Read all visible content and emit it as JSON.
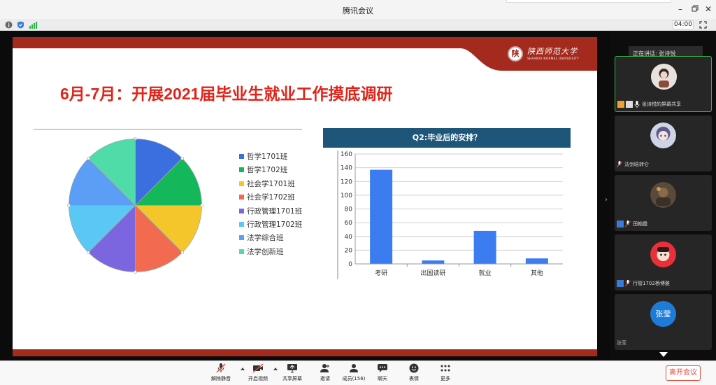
{
  "window": {
    "title": "腾讯会议"
  },
  "infobar": {
    "timer": "04:00"
  },
  "slide": {
    "title": "6月-7月：开展2021届毕业生就业工作摸底调研",
    "logo_name": "陕西师范大学",
    "logo_sub": "SHAANXI NORMAL UNIVERSITY",
    "logo_seal": "陕"
  },
  "chart_data": [
    {
      "type": "pie",
      "categories": [
        "哲学1701班",
        "哲学1702班",
        "社会学1701班",
        "社会学1702班",
        "行政管理1701班",
        "行政管理1702班",
        "法学综合班",
        "法学创新班"
      ],
      "values": [
        12.5,
        12.5,
        12.5,
        12.5,
        12.5,
        12.5,
        12.5,
        12.5
      ],
      "colors": [
        "#3b6fe0",
        "#14b85a",
        "#f5c62a",
        "#f26a4f",
        "#7b66e0",
        "#5ac8f5",
        "#5a9ef5",
        "#4fdca8"
      ],
      "legend": "right"
    },
    {
      "type": "bar",
      "title": "Q2:毕业后的安排？",
      "categories": [
        "考研",
        "出国读研",
        "就业",
        "其他"
      ],
      "values": [
        137,
        5,
        48,
        8
      ],
      "yticks": [
        0,
        20,
        40,
        60,
        80,
        100,
        120,
        140,
        160
      ],
      "ylim": [
        0,
        160
      ],
      "grid": true,
      "color": "#3b7df0"
    }
  ],
  "participants": {
    "speaking": "正在讲话: 张诗悦",
    "tiles": [
      {
        "name": "张诗悦的屏幕共享",
        "active": true
      },
      {
        "name": "法剑晗转仑"
      },
      {
        "name": "田翰霞"
      },
      {
        "name": "行管1702杨博雅"
      },
      {
        "name": "张莹",
        "initials": "张莹"
      }
    ]
  },
  "toolbar": {
    "unmute": "解除静音",
    "video": "开启视频",
    "share": "共享屏幕",
    "invite": "邀请",
    "members": "成员(156)",
    "chat": "聊天",
    "emoji": "表情",
    "more": "更多",
    "leave": "离开会议"
  }
}
